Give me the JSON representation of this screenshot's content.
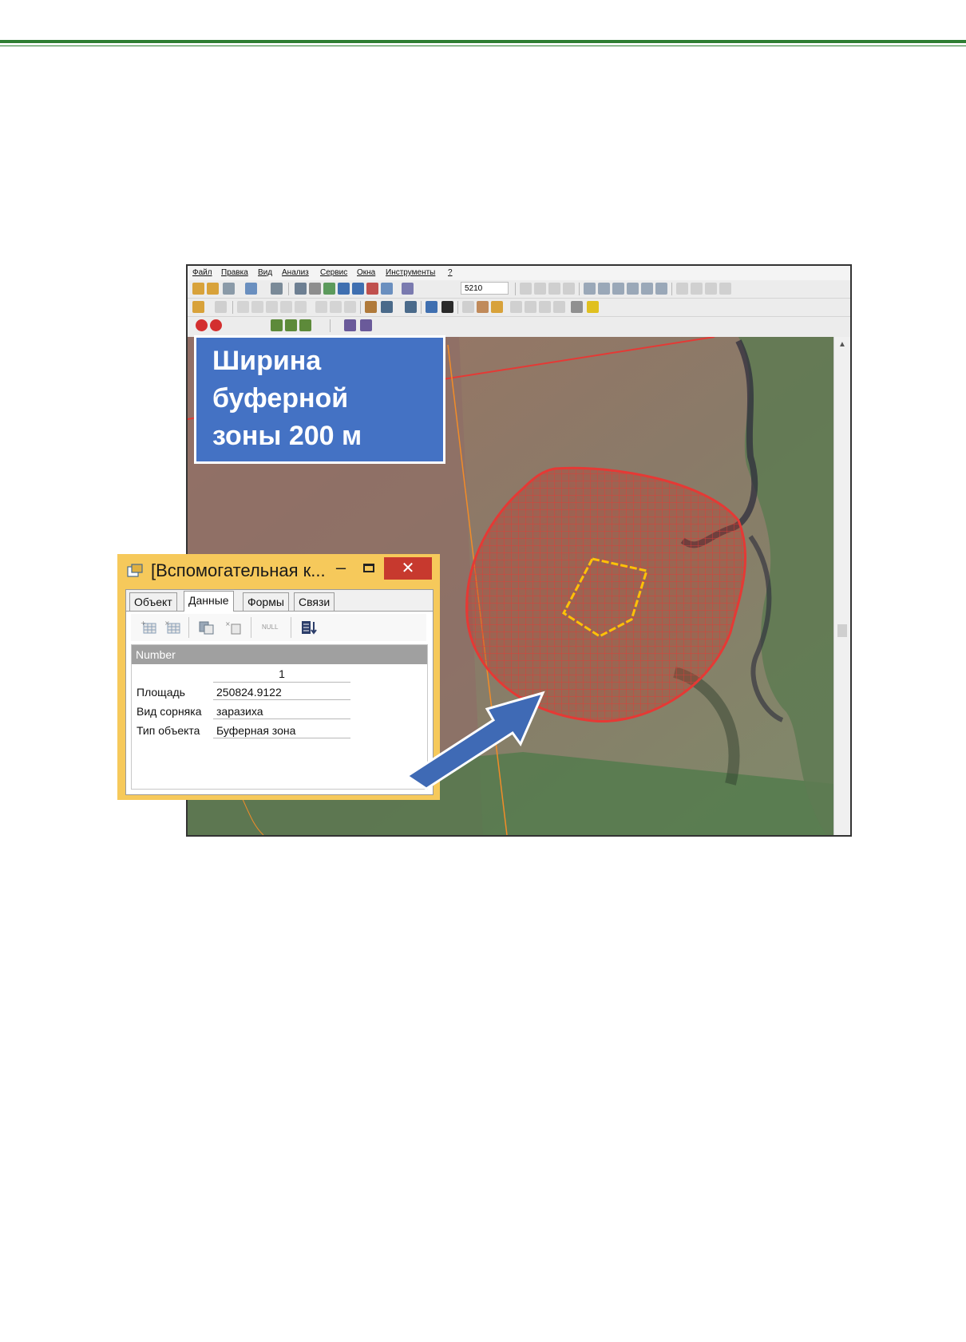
{
  "app": {
    "menu": [
      "Файл",
      "Правка",
      "Вид",
      "Анализ",
      "Сервис",
      "Окна",
      "Инструменты",
      "?"
    ],
    "scale_value": "5210"
  },
  "annotation": {
    "line1": "Ширина",
    "line2": "буферной",
    "line3": "зоны 200 м",
    "color": "#4472c4"
  },
  "popup": {
    "title": "[Вспомогательная к...",
    "minimize_glyph": "–",
    "close_glyph": "✕",
    "tabs": [
      "Объект",
      "Данные",
      "Формы",
      "Связи"
    ],
    "active_tab": "Данные",
    "toolbar_icons": [
      "add-record-icon",
      "delete-record-icon",
      "copy-record-icon",
      "clear-record-icon",
      "null-icon",
      "sort-icon"
    ],
    "toolbar_null_label": "NULL",
    "grid": {
      "header": "Number",
      "record_number": "1",
      "rows": [
        {
          "label": "Площадь",
          "value": "250824.9122"
        },
        {
          "label": "Вид сорняка",
          "value": "заразиха"
        },
        {
          "label": "Тип объекта",
          "value": "Буферная зона"
        }
      ]
    }
  },
  "colors": {
    "buffer_zone": "#e53935",
    "weed_polygon": "#ffc107",
    "top_rule": "#2e7d32",
    "close_button": "#c7392e"
  }
}
